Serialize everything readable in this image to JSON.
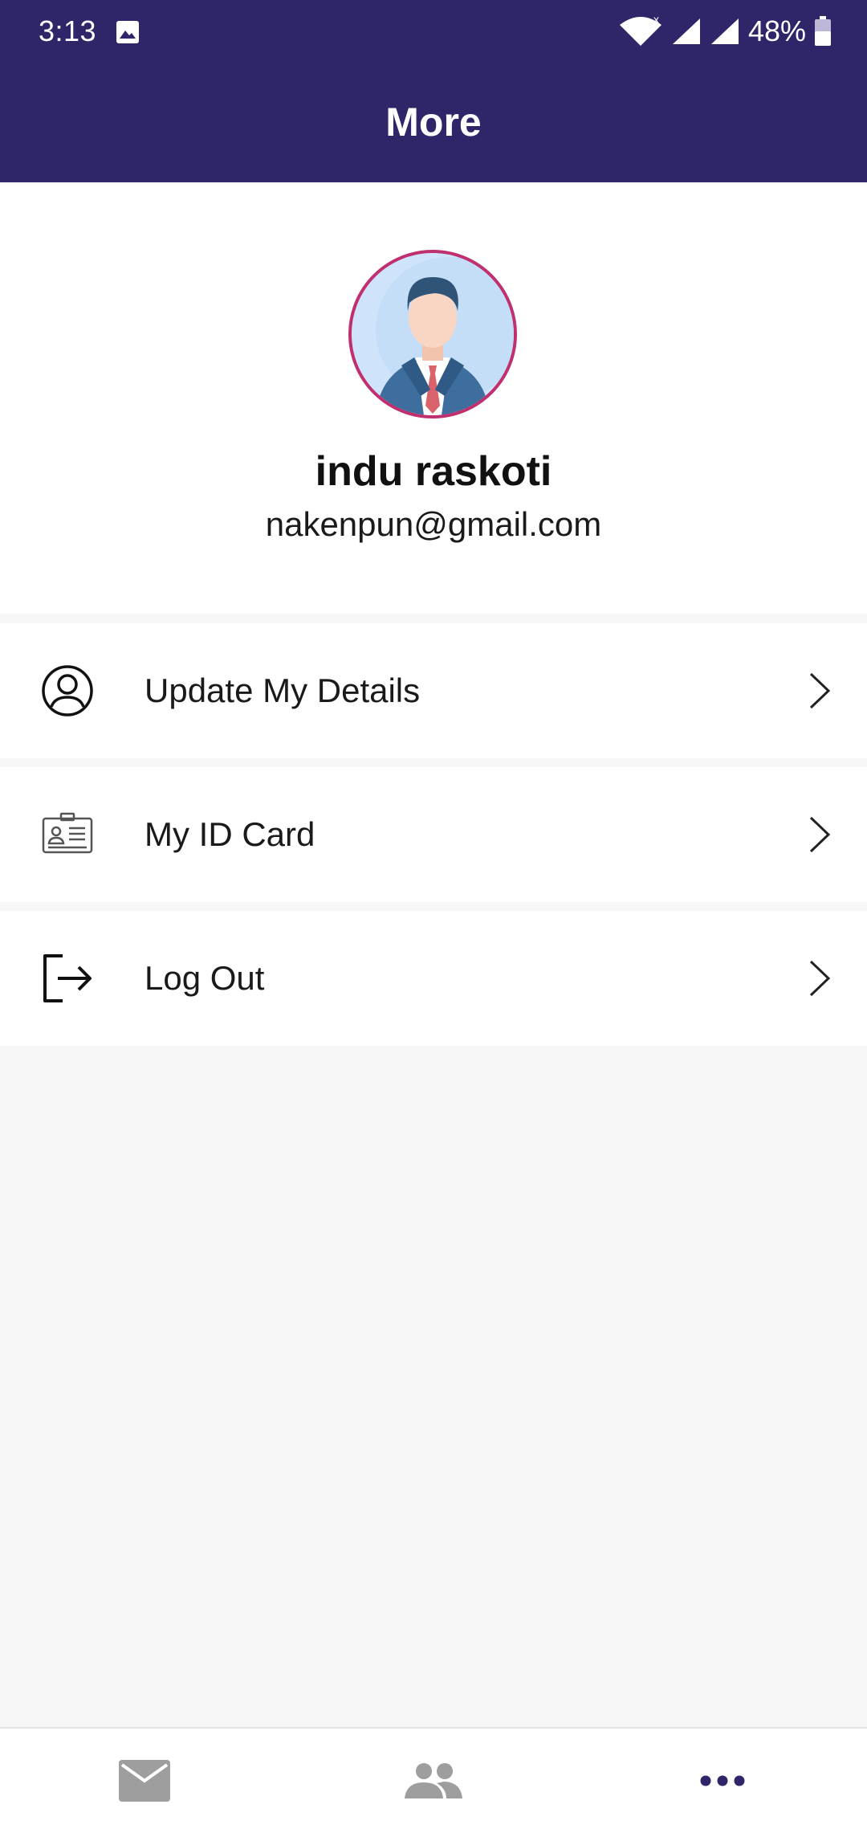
{
  "status": {
    "time": "3:13",
    "battery": "48%"
  },
  "appbar": {
    "title": "More"
  },
  "profile": {
    "name": "indu raskoti",
    "email": "nakenpun@gmail.com"
  },
  "menu": [
    {
      "label": "Update My Details",
      "icon": "user-circle-icon"
    },
    {
      "label": "My ID Card",
      "icon": "id-card-icon"
    },
    {
      "label": "Log Out",
      "icon": "logout-icon"
    }
  ],
  "bottom_nav": [
    {
      "icon": "mail-icon",
      "active": false
    },
    {
      "icon": "people-icon",
      "active": false
    },
    {
      "icon": "more-dots-icon",
      "active": true
    }
  ],
  "colors": {
    "primary": "#2f2669",
    "avatar_ring": "#c0306f",
    "inactive_icon": "#9e9e9e"
  }
}
